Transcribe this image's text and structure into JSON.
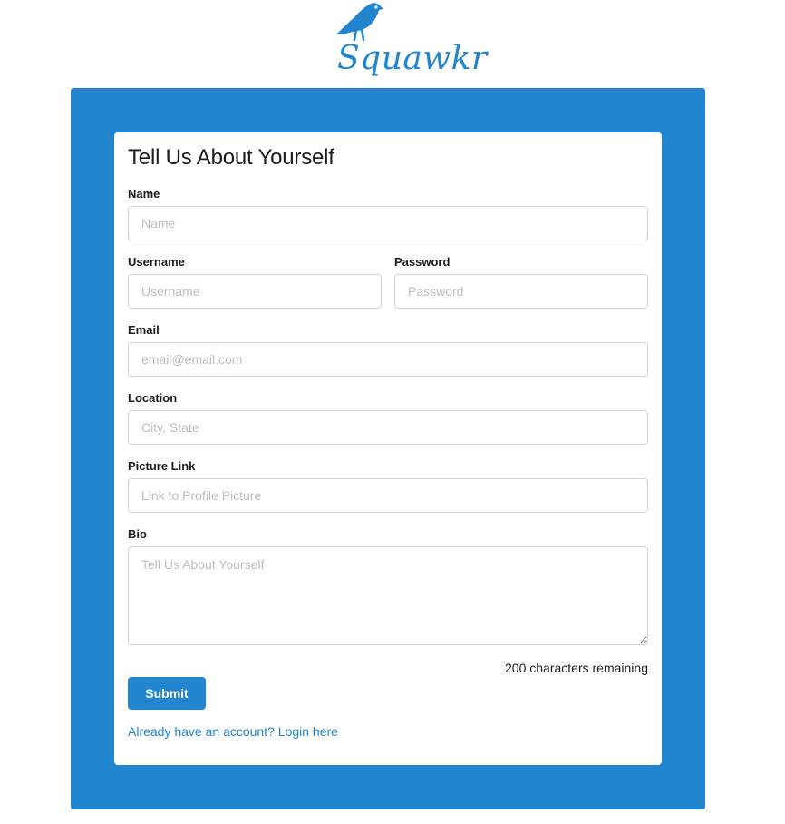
{
  "brand": {
    "name": "Squawkr",
    "color": "#2185d0",
    "icon": "bird-icon"
  },
  "form": {
    "title": "Tell Us About Yourself",
    "fields": {
      "name": {
        "label": "Name",
        "placeholder": "Name",
        "value": ""
      },
      "username": {
        "label": "Username",
        "placeholder": "Username",
        "value": ""
      },
      "password": {
        "label": "Password",
        "placeholder": "Password",
        "value": ""
      },
      "email": {
        "label": "Email",
        "placeholder": "email@email.com",
        "value": ""
      },
      "location": {
        "label": "Location",
        "placeholder": "City, State",
        "value": ""
      },
      "picture": {
        "label": "Picture Link",
        "placeholder": "Link to Profile Picture",
        "value": ""
      },
      "bio": {
        "label": "Bio",
        "placeholder": "Tell Us About Yourself",
        "value": ""
      }
    },
    "characters_remaining": "200 characters remaining",
    "submit_label": "Submit",
    "login_link": "Already have an account? Login here"
  },
  "colors": {
    "accent": "#2185d0",
    "panel_background": "#2185d0",
    "card_background": "#ffffff",
    "input_border": "#d4d4d5",
    "placeholder": "#bdbdbd"
  }
}
